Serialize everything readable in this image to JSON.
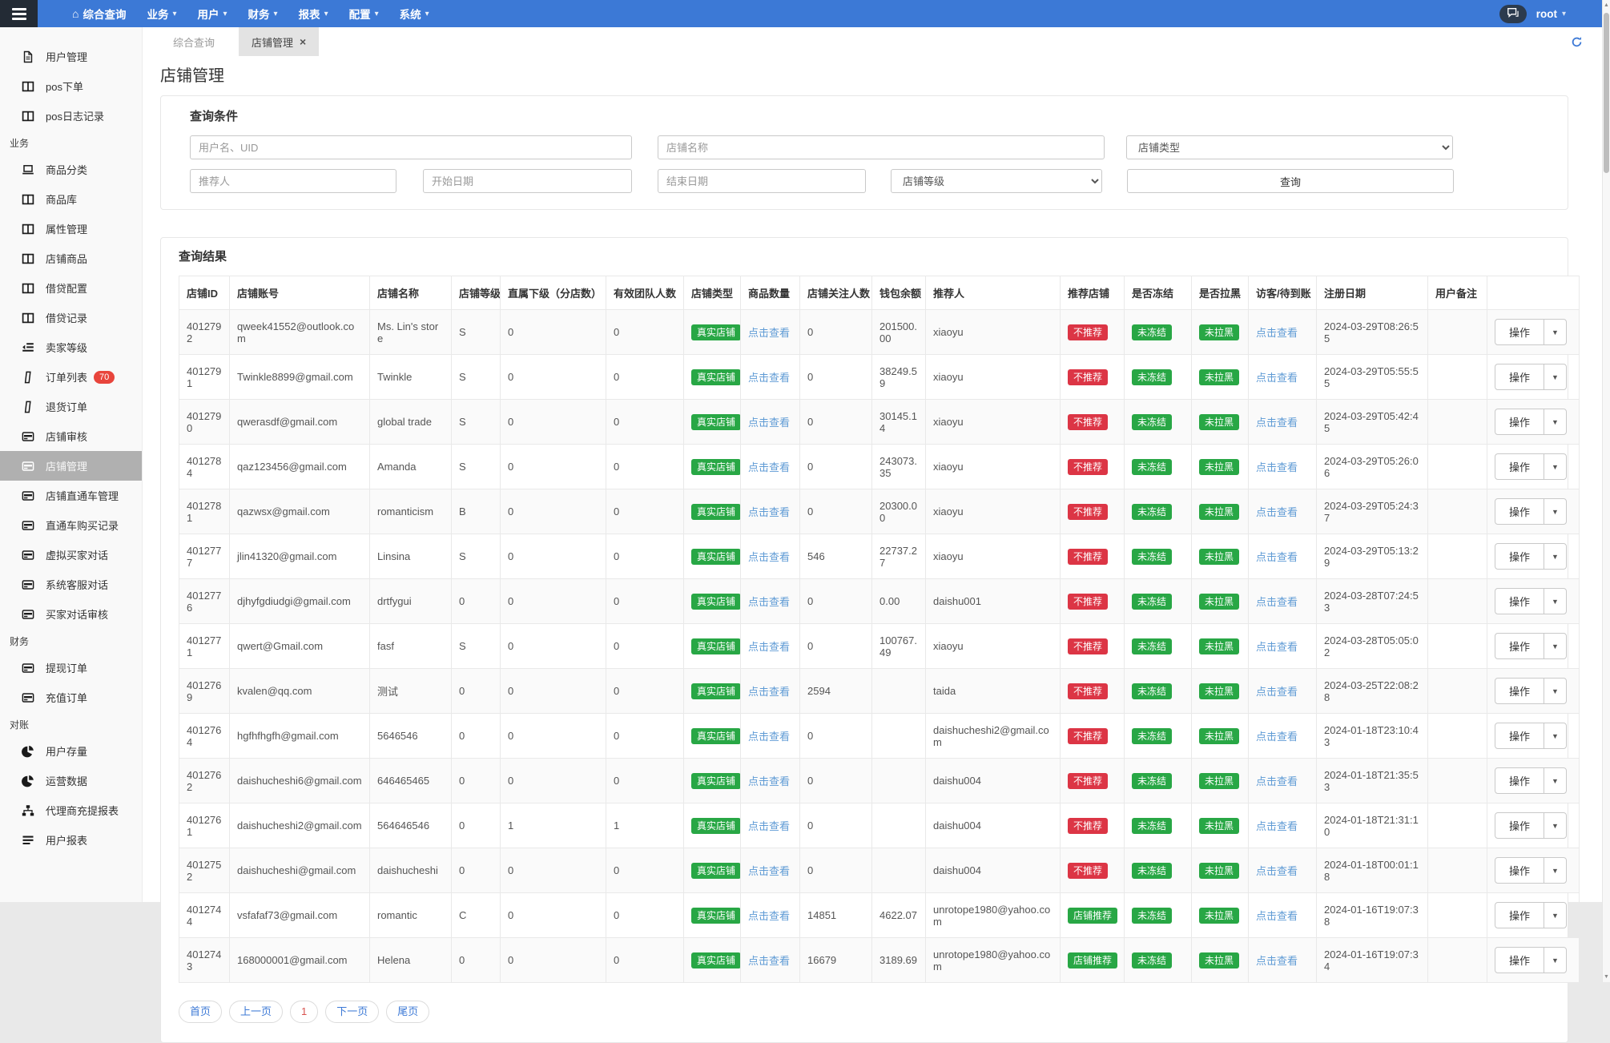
{
  "colors": {
    "navbar": "#3c79d6",
    "navbar_dark": "#232b35",
    "primary": "#3c79d6",
    "success": "#28a745",
    "danger": "#dc3545",
    "link": "#5f9bd5",
    "badge_count": "#e8453c"
  },
  "navbar": {
    "menu": [
      {
        "key": "dashboard",
        "label": "综合查询",
        "icon": "home",
        "caret": false
      },
      {
        "key": "business",
        "label": "业务",
        "caret": true
      },
      {
        "key": "users",
        "label": "用户",
        "caret": true
      },
      {
        "key": "finance",
        "label": "财务",
        "caret": true
      },
      {
        "key": "reports",
        "label": "报表",
        "caret": true
      },
      {
        "key": "config",
        "label": "配置",
        "caret": true
      },
      {
        "key": "system",
        "label": "系统",
        "caret": true
      }
    ],
    "user": {
      "name": "root"
    }
  },
  "sidebar": {
    "items": [
      {
        "type": "link",
        "key": "user-management",
        "icon": "file",
        "label": "用户管理"
      },
      {
        "type": "link",
        "key": "pos-order",
        "icon": "table",
        "label": "pos下单"
      },
      {
        "type": "link",
        "key": "pos-log",
        "icon": "table",
        "label": "pos日志记录"
      },
      {
        "type": "section",
        "label": "业务"
      },
      {
        "type": "link",
        "key": "goods-category",
        "icon": "laptop",
        "label": "商品分类"
      },
      {
        "type": "link",
        "key": "goods-library",
        "icon": "table",
        "label": "商品库"
      },
      {
        "type": "link",
        "key": "attribute-management",
        "icon": "table",
        "label": "属性管理"
      },
      {
        "type": "link",
        "key": "shop-goods",
        "icon": "table",
        "label": "店铺商品"
      },
      {
        "type": "link",
        "key": "loan-config",
        "icon": "table",
        "label": "借贷配置"
      },
      {
        "type": "link",
        "key": "loan-records",
        "icon": "table",
        "label": "借贷记录"
      },
      {
        "type": "link",
        "key": "seller-level",
        "icon": "indent",
        "label": "卖家等级"
      },
      {
        "type": "link",
        "key": "order-list",
        "icon": "phone",
        "label": "订单列表",
        "badge": "70"
      },
      {
        "type": "link",
        "key": "return-orders",
        "icon": "phone",
        "label": "退货订单"
      },
      {
        "type": "link",
        "key": "shop-review",
        "icon": "card",
        "label": "店铺审核"
      },
      {
        "type": "link",
        "key": "shop-management",
        "icon": "card",
        "label": "店铺管理",
        "active": true
      },
      {
        "type": "link",
        "key": "shop-train-management",
        "icon": "card",
        "label": "店铺直通车管理"
      },
      {
        "type": "link",
        "key": "train-purchase-records",
        "icon": "card",
        "label": "直通车购买记录"
      },
      {
        "type": "link",
        "key": "virtual-buyer-chat",
        "icon": "card",
        "label": "虚拟买家对话"
      },
      {
        "type": "link",
        "key": "system-service-chat",
        "icon": "card",
        "label": "系统客服对话"
      },
      {
        "type": "link",
        "key": "buyer-chat-review",
        "icon": "card",
        "label": "买家对话审核"
      },
      {
        "type": "section",
        "label": "财务"
      },
      {
        "type": "link",
        "key": "withdraw-orders",
        "icon": "card",
        "label": "提现订单"
      },
      {
        "type": "link",
        "key": "recharge-orders",
        "icon": "card",
        "label": "充值订单"
      },
      {
        "type": "section",
        "label": "对账"
      },
      {
        "type": "link",
        "key": "user-balance",
        "icon": "pie",
        "label": "用户存量"
      },
      {
        "type": "link",
        "key": "operation-data",
        "icon": "pie",
        "label": "运营数据"
      },
      {
        "type": "link",
        "key": "agent-report",
        "icon": "sitemap",
        "label": "代理商充提报表"
      },
      {
        "type": "link",
        "key": "user-report",
        "icon": "list",
        "label": "用户报表"
      }
    ]
  },
  "tabs": [
    {
      "key": "dashboard",
      "label": "综合查询",
      "active": false,
      "closable": false
    },
    {
      "key": "shop-management",
      "label": "店铺管理",
      "active": true,
      "closable": true
    }
  ],
  "page_title": "店铺管理",
  "query": {
    "title": "查询条件",
    "username_placeholder": "用户名、UID",
    "shopname_placeholder": "店铺名称",
    "shoptype_value": "店铺类型",
    "referrer_placeholder": "推荐人",
    "startdate_placeholder": "开始日期",
    "enddate_placeholder": "结束日期",
    "shoplevel_value": "店铺等级",
    "search_label": "查询"
  },
  "results": {
    "title": "查询结果",
    "link_label": "点击查看",
    "action_label": "操作",
    "columns": [
      {
        "key": "id",
        "label": "店铺ID"
      },
      {
        "key": "account",
        "label": "店铺账号"
      },
      {
        "key": "name",
        "label": "店铺名称"
      },
      {
        "key": "level",
        "label": "店铺等级"
      },
      {
        "key": "subs",
        "label": "直属下级（分店数）"
      },
      {
        "key": "team",
        "label": "有效团队人数"
      },
      {
        "key": "type",
        "label": "店铺类型"
      },
      {
        "key": "goods",
        "label": "商品数量"
      },
      {
        "key": "followers",
        "label": "店铺关注人数"
      },
      {
        "key": "balance",
        "label": "钱包余额"
      },
      {
        "key": "referrer",
        "label": "推荐人"
      },
      {
        "key": "recommend",
        "label": "推荐店铺"
      },
      {
        "key": "frozen",
        "label": "是否冻结"
      },
      {
        "key": "black",
        "label": "是否拉黑"
      },
      {
        "key": "visitors",
        "label": "访客/待到账"
      },
      {
        "key": "regdate",
        "label": "注册日期"
      },
      {
        "key": "remark",
        "label": "用户备注"
      },
      {
        "key": "actions",
        "label": ""
      }
    ],
    "rows": [
      {
        "id": "4012792",
        "account": "qweek41552@outlook.com",
        "name": "Ms. Lin's store",
        "level": "S",
        "subs": "0",
        "team": "0",
        "type": "真实店铺",
        "followers": "0",
        "balance": "201500.00",
        "referrer": "xiaoyu",
        "recommend": {
          "text": "不推荐",
          "variant": "danger"
        },
        "frozen": "未冻结",
        "black": "未拉黑",
        "regdate": "2024-03-29T08:26:55",
        "remark": ""
      },
      {
        "id": "4012791",
        "account": "Twinkle8899@gmail.com",
        "name": "Twinkle",
        "level": "S",
        "subs": "0",
        "team": "0",
        "type": "真实店铺",
        "followers": "0",
        "balance": "38249.59",
        "referrer": "xiaoyu",
        "recommend": {
          "text": "不推荐",
          "variant": "danger"
        },
        "frozen": "未冻结",
        "black": "未拉黑",
        "regdate": "2024-03-29T05:55:55",
        "remark": ""
      },
      {
        "id": "4012790",
        "account": "qwerasdf@gmail.com",
        "name": "global trade",
        "level": "S",
        "subs": "0",
        "team": "0",
        "type": "真实店铺",
        "followers": "0",
        "balance": "30145.14",
        "referrer": "xiaoyu",
        "recommend": {
          "text": "不推荐",
          "variant": "danger"
        },
        "frozen": "未冻结",
        "black": "未拉黑",
        "regdate": "2024-03-29T05:42:45",
        "remark": ""
      },
      {
        "id": "4012784",
        "account": "qaz123456@gmail.com",
        "name": "Amanda",
        "level": "S",
        "subs": "0",
        "team": "0",
        "type": "真实店铺",
        "followers": "0",
        "balance": "243073.35",
        "referrer": "xiaoyu",
        "recommend": {
          "text": "不推荐",
          "variant": "danger"
        },
        "frozen": "未冻结",
        "black": "未拉黑",
        "regdate": "2024-03-29T05:26:06",
        "remark": ""
      },
      {
        "id": "4012781",
        "account": "qazwsx@gmail.com",
        "name": "romanticism",
        "level": "B",
        "subs": "0",
        "team": "0",
        "type": "真实店铺",
        "followers": "0",
        "balance": "20300.00",
        "referrer": "xiaoyu",
        "recommend": {
          "text": "不推荐",
          "variant": "danger"
        },
        "frozen": "未冻结",
        "black": "未拉黑",
        "regdate": "2024-03-29T05:24:37",
        "remark": ""
      },
      {
        "id": "4012777",
        "account": "jlin41320@gmail.com",
        "name": "Linsina",
        "level": "S",
        "subs": "0",
        "team": "0",
        "type": "真实店铺",
        "followers": "546",
        "balance": "22737.27",
        "referrer": "xiaoyu",
        "recommend": {
          "text": "不推荐",
          "variant": "danger"
        },
        "frozen": "未冻结",
        "black": "未拉黑",
        "regdate": "2024-03-29T05:13:29",
        "remark": ""
      },
      {
        "id": "4012776",
        "account": "djhyfgdiudgi@gmail.com",
        "name": "drtfygui",
        "level": "0",
        "subs": "0",
        "team": "0",
        "type": "真实店铺",
        "followers": "0",
        "balance": "0.00",
        "referrer": "daishu001",
        "recommend": {
          "text": "不推荐",
          "variant": "danger"
        },
        "frozen": "未冻结",
        "black": "未拉黑",
        "regdate": "2024-03-28T07:24:53",
        "remark": ""
      },
      {
        "id": "4012771",
        "account": "qwert@Gmail.com",
        "name": "fasf",
        "level": "S",
        "subs": "0",
        "team": "0",
        "type": "真实店铺",
        "followers": "0",
        "balance": "100767.49",
        "referrer": "xiaoyu",
        "recommend": {
          "text": "不推荐",
          "variant": "danger"
        },
        "frozen": "未冻结",
        "black": "未拉黑",
        "regdate": "2024-03-28T05:05:02",
        "remark": ""
      },
      {
        "id": "4012769",
        "account": "kvalen@qq.com",
        "name": "测试",
        "level": "0",
        "subs": "0",
        "team": "0",
        "type": "真实店铺",
        "followers": "2594",
        "balance": "",
        "referrer": "taida",
        "recommend": {
          "text": "不推荐",
          "variant": "danger"
        },
        "frozen": "未冻结",
        "black": "未拉黑",
        "regdate": "2024-03-25T22:08:28",
        "remark": ""
      },
      {
        "id": "4012764",
        "account": "hgfhfhgfh@gmail.com",
        "name": "5646546",
        "level": "0",
        "subs": "0",
        "team": "0",
        "type": "真实店铺",
        "followers": "0",
        "balance": "",
        "referrer": "daishucheshi2@gmail.com",
        "recommend": {
          "text": "不推荐",
          "variant": "danger"
        },
        "frozen": "未冻结",
        "black": "未拉黑",
        "regdate": "2024-01-18T23:10:43",
        "remark": ""
      },
      {
        "id": "4012762",
        "account": "daishucheshi6@gmail.com",
        "name": "646465465",
        "level": "0",
        "subs": "0",
        "team": "0",
        "type": "真实店铺",
        "followers": "0",
        "balance": "",
        "referrer": "daishu004",
        "recommend": {
          "text": "不推荐",
          "variant": "danger"
        },
        "frozen": "未冻结",
        "black": "未拉黑",
        "regdate": "2024-01-18T21:35:53",
        "remark": ""
      },
      {
        "id": "4012761",
        "account": "daishucheshi2@gmail.com",
        "name": "564646546",
        "level": "0",
        "subs": "1",
        "team": "1",
        "type": "真实店铺",
        "followers": "0",
        "balance": "",
        "referrer": "daishu004",
        "recommend": {
          "text": "不推荐",
          "variant": "danger"
        },
        "frozen": "未冻结",
        "black": "未拉黑",
        "regdate": "2024-01-18T21:31:10",
        "remark": ""
      },
      {
        "id": "4012752",
        "account": "daishucheshi@gmail.com",
        "name": "daishucheshi",
        "level": "0",
        "subs": "0",
        "team": "0",
        "type": "真实店铺",
        "followers": "0",
        "balance": "",
        "referrer": "daishu004",
        "recommend": {
          "text": "不推荐",
          "variant": "danger"
        },
        "frozen": "未冻结",
        "black": "未拉黑",
        "regdate": "2024-01-18T00:01:18",
        "remark": ""
      },
      {
        "id": "4012744",
        "account": "vsfafaf73@gmail.com",
        "name": "romantic",
        "level": "C",
        "subs": "0",
        "team": "0",
        "type": "真实店铺",
        "followers": "14851",
        "balance": "4622.07",
        "referrer": "unrotope1980@yahoo.com",
        "recommend": {
          "text": "店铺推荐",
          "variant": "success"
        },
        "frozen": "未冻结",
        "black": "未拉黑",
        "regdate": "2024-01-16T19:07:38",
        "remark": ""
      },
      {
        "id": "4012743",
        "account": "168000001@gmail.com",
        "name": "Helena",
        "level": "0",
        "subs": "0",
        "team": "0",
        "type": "真实店铺",
        "followers": "16679",
        "balance": "3189.69",
        "referrer": "unrotope1980@yahoo.com",
        "recommend": {
          "text": "店铺推荐",
          "variant": "success"
        },
        "frozen": "未冻结",
        "black": "未拉黑",
        "regdate": "2024-01-16T19:07:34",
        "remark": ""
      }
    ],
    "pagination": [
      {
        "key": "first",
        "label": "首页"
      },
      {
        "key": "prev",
        "label": "上一页"
      },
      {
        "key": "page-1",
        "label": "1",
        "current": true
      },
      {
        "key": "next",
        "label": "下一页"
      },
      {
        "key": "last",
        "label": "尾页"
      }
    ]
  }
}
